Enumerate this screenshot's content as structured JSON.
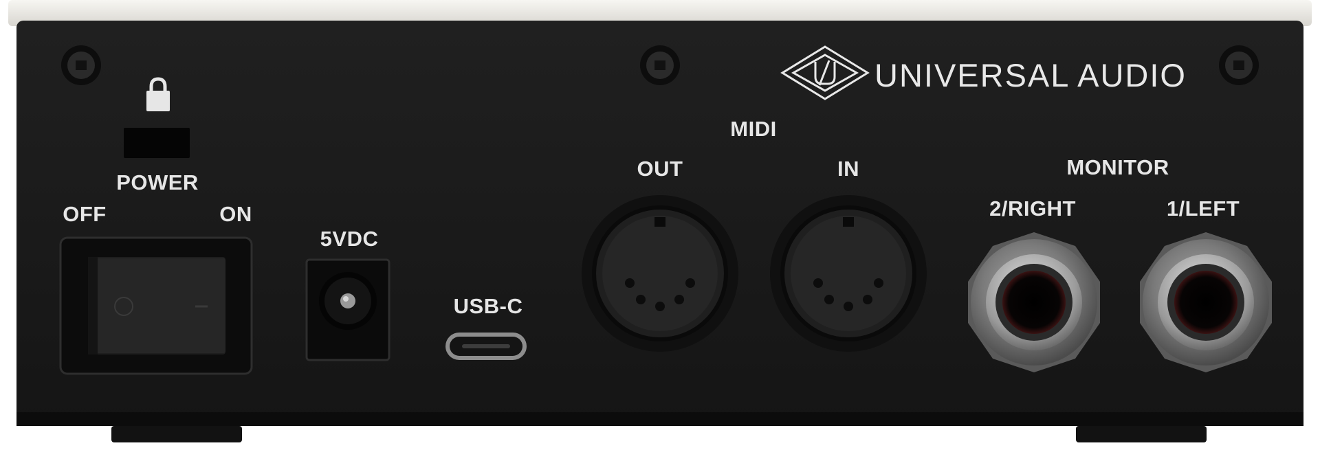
{
  "brand": {
    "logo_icon": "ua-diamond-logo-icon",
    "name": "UNIVERSAL AUDIO"
  },
  "power": {
    "lock_icon": "padlock-icon",
    "label": "POWER",
    "off_label": "OFF",
    "on_label": "ON"
  },
  "dc": {
    "label": "5VDC"
  },
  "usb": {
    "label": "USB-C"
  },
  "midi": {
    "label": "MIDI",
    "out_label": "OUT",
    "in_label": "IN"
  },
  "monitor": {
    "label": "MONITOR",
    "right_label": "2/RIGHT",
    "left_label": "1/LEFT"
  },
  "colors": {
    "panel": "#1b1b1b",
    "top_trim": "#eceae6",
    "label_text": "#e6e6e6",
    "jack_metal": "#8a8a8a"
  }
}
